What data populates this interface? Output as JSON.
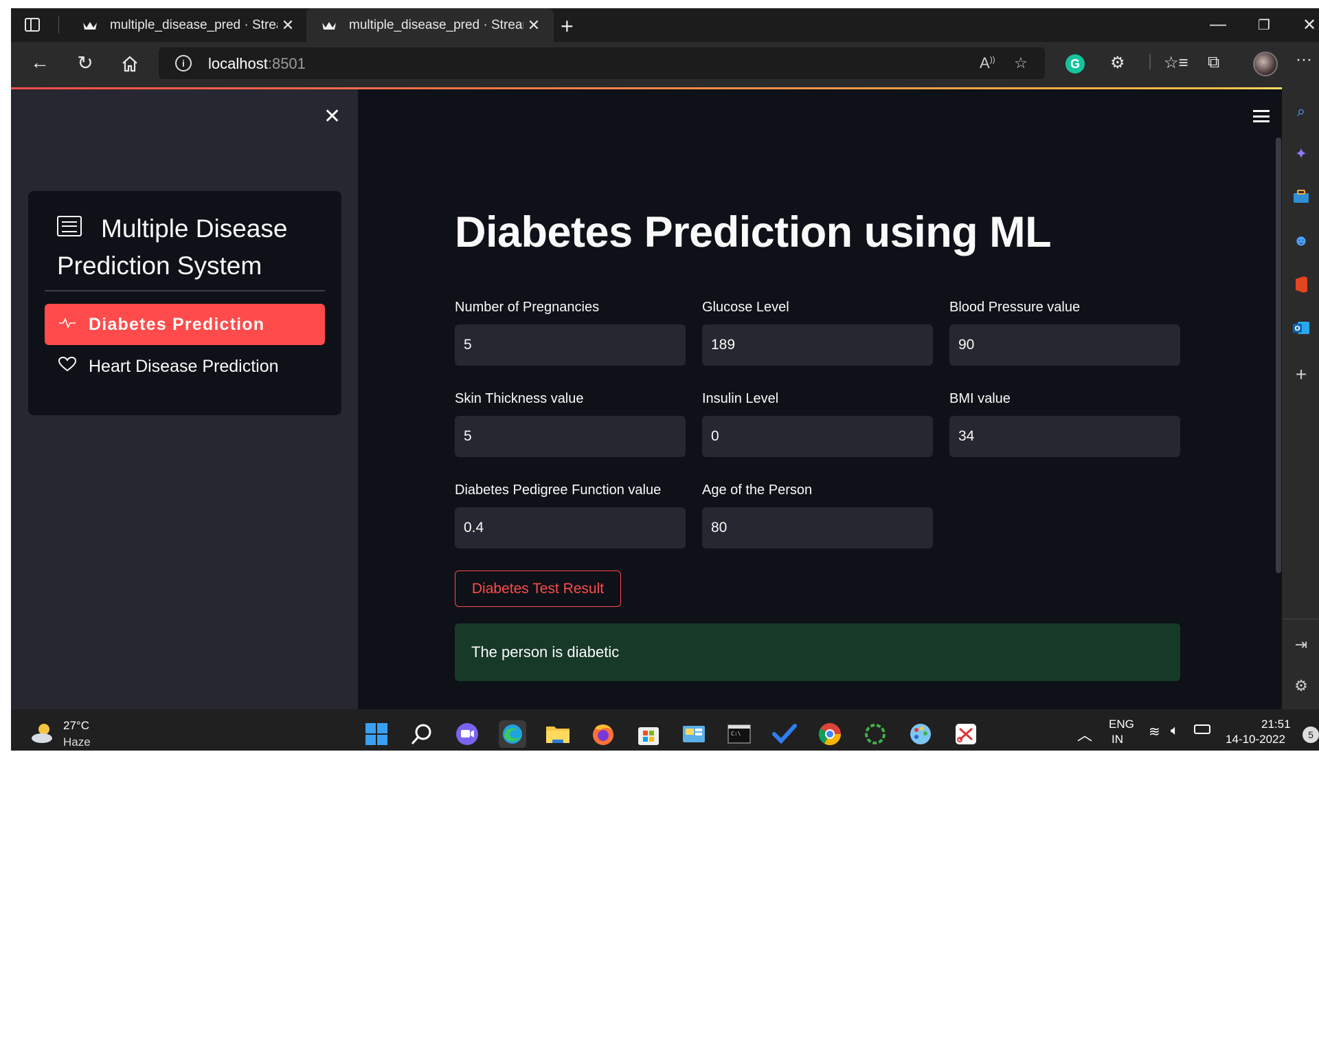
{
  "browser": {
    "tabs": [
      {
        "title": "multiple_disease_pred · Streamlit",
        "active": false
      },
      {
        "title": "multiple_disease_pred · Streamlit",
        "active": true
      }
    ],
    "url_host": "localhost",
    "url_port": ":8501"
  },
  "sidebar": {
    "title": "Multiple Disease Prediction System",
    "items": [
      {
        "label": "Diabetes Prediction",
        "icon": "activity-icon",
        "selected": true
      },
      {
        "label": "Heart Disease Prediction",
        "icon": "heart-icon",
        "selected": false
      }
    ]
  },
  "main": {
    "title": "Diabetes Prediction using ML",
    "fields": [
      {
        "label": "Number of Pregnancies",
        "value": "5"
      },
      {
        "label": "Glucose Level",
        "value": "189"
      },
      {
        "label": "Blood Pressure value",
        "value": "90"
      },
      {
        "label": "Skin Thickness value",
        "value": "5"
      },
      {
        "label": "Insulin Level",
        "value": "0"
      },
      {
        "label": "BMI value",
        "value": "34"
      },
      {
        "label": "Diabetes Pedigree Function value",
        "value": "0.4"
      },
      {
        "label": "Age of the Person",
        "value": "80"
      }
    ],
    "button_label": "Diabetes Test Result",
    "result_text": "The person is diabetic"
  },
  "taskbar": {
    "weather_temp": "27°C",
    "weather_desc": "Haze",
    "lang_line1": "ENG",
    "lang_line2": "IN",
    "time": "21:51",
    "date": "14-10-2022",
    "notification_count": "5"
  },
  "colors": {
    "accent": "#ff4b4b",
    "background": "#0e1117",
    "sidebar": "#262730",
    "success_bg": "#173928"
  }
}
